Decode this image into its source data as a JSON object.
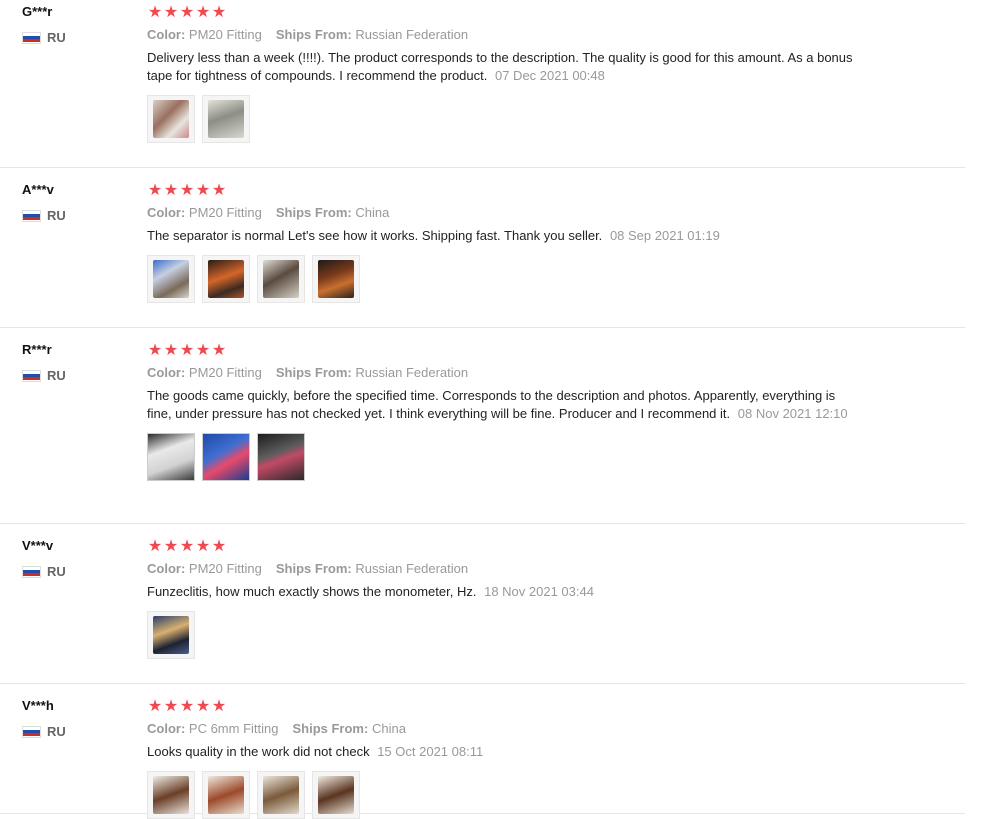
{
  "labels": {
    "color": "Color:",
    "ships_from": "Ships From:"
  },
  "reviews": [
    {
      "user": "G***r",
      "country": "RU",
      "stars": 5,
      "color": "PM20 Fitting",
      "ships_from": "Russian Federation",
      "text": "Delivery less than a week (!!!!). The product corresponds to the description. The quality is good for this amount. As a bonus tape for tightness of compounds. I recommend the product.",
      "date": "07 Dec 2021 00:48",
      "photos": [
        "product-photo",
        "product-photo"
      ]
    },
    {
      "user": "A***v",
      "country": "RU",
      "stars": 5,
      "color": "PM20 Fitting",
      "ships_from": "China",
      "text": "The separator is normal Let's see how it works. Shipping fast. Thank you seller.",
      "date": "08 Sep 2021 01:19",
      "photos": [
        "product-photo",
        "product-photo",
        "product-photo",
        "product-photo"
      ]
    },
    {
      "user": "R***r",
      "country": "RU",
      "stars": 5,
      "color": "PM20 Fitting",
      "ships_from": "Russian Federation",
      "text": "The goods came quickly, before the specified time. Corresponds to the description and photos. Apparently, everything is fine, under pressure has not checked yet. I think everything will be fine. Producer and I recommend it.",
      "date": "08 Nov 2021 12:10",
      "photos": [
        "product-photo",
        "product-photo",
        "product-photo"
      ]
    },
    {
      "user": "V***v",
      "country": "RU",
      "stars": 5,
      "color": "PM20 Fitting",
      "ships_from": "Russian Federation",
      "text": "Funzeclitis, how much exactly shows the monometer, Hz.",
      "date": "18 Nov 2021 03:44",
      "photos": [
        "product-photo"
      ]
    },
    {
      "user": "V***h",
      "country": "RU",
      "stars": 5,
      "color": "PC 6mm Fitting",
      "ships_from": "China",
      "text": "Looks quality in the work did not check",
      "date": "15 Oct 2021 08:11",
      "photos": [
        "product-photo",
        "product-photo",
        "product-photo",
        "product-photo"
      ]
    }
  ],
  "colors": {
    "star": "#f0494f",
    "muted": "#999999",
    "divider": "#e6e6e6"
  }
}
